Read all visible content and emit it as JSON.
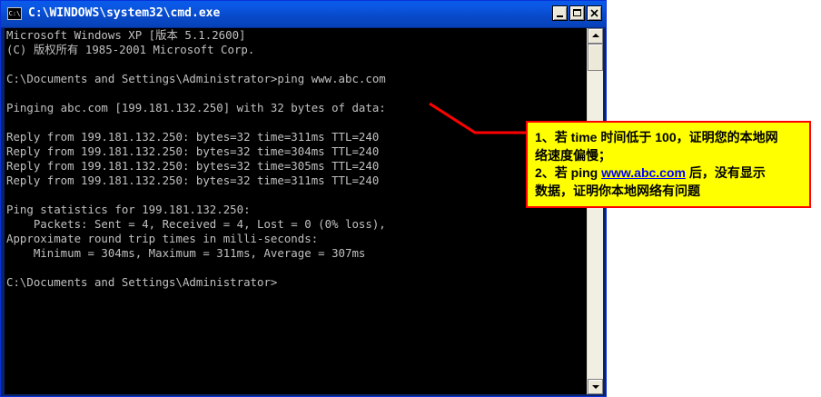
{
  "window": {
    "title": "C:\\WINDOWS\\system32\\cmd.exe",
    "icon": "cmd-icon",
    "icon_text": "C:\\",
    "controls": [
      "minimize-icon",
      "maximize-icon",
      "close-icon"
    ]
  },
  "console": {
    "lines": [
      "Microsoft Windows XP [版本 5.1.2600]",
      "(C) 版权所有 1985-2001 Microsoft Corp.",
      "",
      "C:\\Documents and Settings\\Administrator>ping www.abc.com",
      "",
      "Pinging abc.com [199.181.132.250] with 32 bytes of data:",
      "",
      "Reply from 199.181.132.250: bytes=32 time=311ms TTL=240",
      "Reply from 199.181.132.250: bytes=32 time=304ms TTL=240",
      "Reply from 199.181.132.250: bytes=32 time=305ms TTL=240",
      "Reply from 199.181.132.250: bytes=32 time=311ms TTL=240",
      "",
      "Ping statistics for 199.181.132.250:",
      "    Packets: Sent = 4, Received = 4, Lost = 0 (0% loss),",
      "Approximate round trip times in milli-seconds:",
      "    Minimum = 304ms, Maximum = 311ms, Average = 307ms",
      "",
      "C:\\Documents and Settings\\Administrator>"
    ]
  },
  "callout": {
    "line1": "1、若 time 时间低于 100，证明您的本地网",
    "line2": "络速度偏慢；",
    "line3_prefix": "2、若 ping ",
    "line3_link": "www.abc.com",
    "line3_suffix": " 后，没有显示",
    "line4": "数据，证明你本地网络有问题"
  },
  "colors": {
    "titlebar": "#0a58e5",
    "console_bg": "#000000",
    "console_text": "#c0c0c0",
    "callout_bg": "#ffff00",
    "callout_border": "#ff0000",
    "link": "#0000ff",
    "arrow": "#ff0000"
  }
}
